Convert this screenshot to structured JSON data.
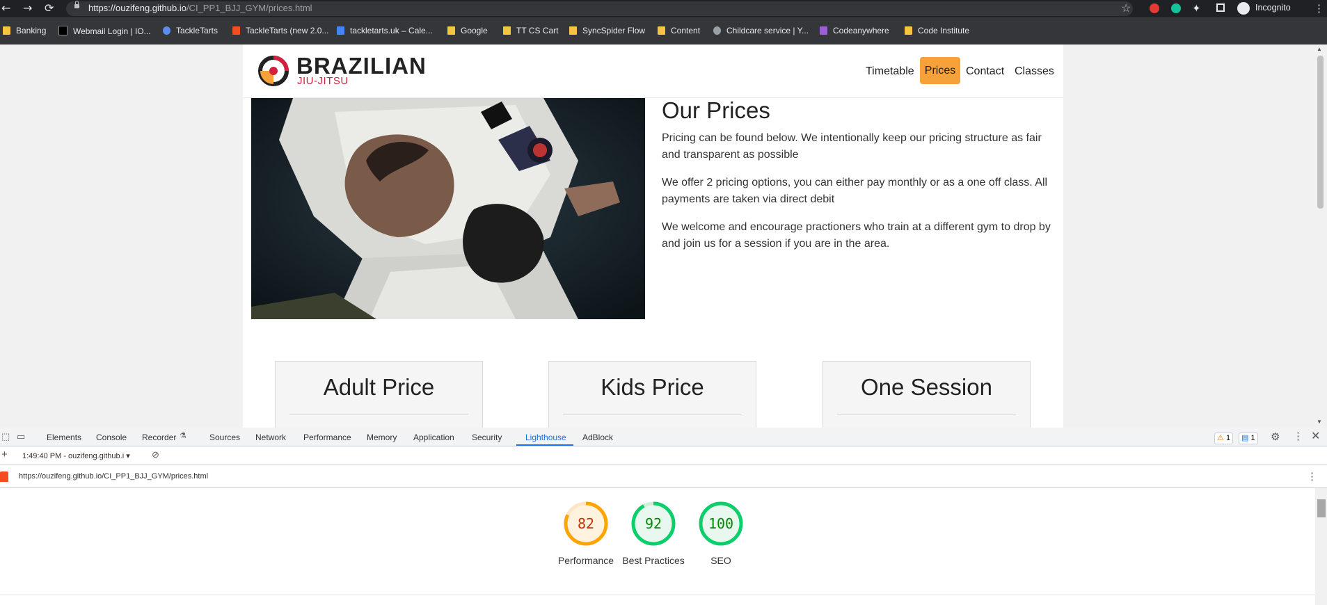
{
  "browser": {
    "url_host": "https://ouzifeng.github.io",
    "url_path": "/CI_PP1_BJJ_GYM/prices.html",
    "incognito_label": "Incognito"
  },
  "bookmarks": [
    {
      "label": "Banking",
      "icon": "folder-icon"
    },
    {
      "label": "Webmail Login | IO...",
      "icon": "site-icon"
    },
    {
      "label": "TackleTarts",
      "icon": "site-icon"
    },
    {
      "label": "TackleTarts (new 2.0...",
      "icon": "figma-icon"
    },
    {
      "label": "tackletarts.uk – Cale...",
      "icon": "calendar-icon"
    },
    {
      "label": "Google",
      "icon": "folder-icon"
    },
    {
      "label": "TT CS Cart",
      "icon": "folder-icon"
    },
    {
      "label": "SyncSpider Flow",
      "icon": "folder-icon"
    },
    {
      "label": "Content",
      "icon": "folder-icon"
    },
    {
      "label": "Childcare service | Y...",
      "icon": "globe-icon"
    },
    {
      "label": "Codeanywhere",
      "icon": "site-icon"
    },
    {
      "label": "Code Institute",
      "icon": "folder-icon"
    }
  ],
  "site": {
    "brand": "BRAZILIAN",
    "brand_sub": "JIU-JITSU",
    "nav": {
      "timetable": "Timetable",
      "prices": "Prices",
      "contact": "Contact",
      "classes": "Classes"
    },
    "title": "Our Prices",
    "paragraphs": [
      "Pricing can be found below. We intentionally keep our pricing structure as fair and transparent as possible",
      "We offer 2 pricing options, you can either pay monthly or as a one off class. All payments are taken via direct debit",
      "We welcome and encourage practioners who train at a different gym to drop by and join us for a session if you are in the area."
    ],
    "cards": [
      "Adult Price",
      "Kids Price",
      "One Session"
    ]
  },
  "devtools": {
    "tabs": [
      "Elements",
      "Console",
      "Recorder",
      "Sources",
      "Network",
      "Performance",
      "Memory",
      "Application",
      "Security",
      "Lighthouse",
      "AdBlock"
    ],
    "active_tab": "Lighthouse",
    "warnings": "1",
    "messages": "1",
    "report_selector": "1:49:40 PM - ouzifeng.github.i",
    "report_url": "https://ouzifeng.github.io/CI_PP1_BJJ_GYM/prices.html",
    "scores": [
      {
        "label": "Performance",
        "value": "82",
        "color": "#c33300",
        "ring": "#ffa400",
        "bg": "#fff3e0"
      },
      {
        "label": "Best Practices",
        "value": "92",
        "color": "#008800",
        "ring": "#0cce6b",
        "bg": "#e8f8ee"
      },
      {
        "label": "SEO",
        "value": "100",
        "color": "#008800",
        "ring": "#0cce6b",
        "bg": "#e8f8ee"
      }
    ]
  }
}
